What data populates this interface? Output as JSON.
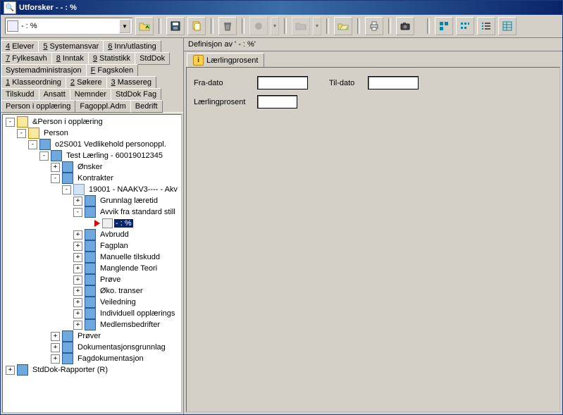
{
  "window": {
    "title": "Utforsker -  - : %"
  },
  "combo": {
    "text": " - : %"
  },
  "left_tabs": [
    [
      {
        "k": "4",
        "t": " Elever"
      },
      {
        "k": "5",
        "t": " Systemansvar"
      },
      {
        "k": "6",
        "t": " Inn/utlasting"
      }
    ],
    [
      {
        "k": "7",
        "t": " Fylkesavh"
      },
      {
        "k": "8",
        "t": " Inntak"
      },
      {
        "k": "9",
        "t": " Statistikk"
      },
      {
        "k": "",
        "t": "StdDok"
      }
    ],
    [
      {
        "k": "",
        "t": "Systemadministrasjon"
      },
      {
        "k": "F",
        "t": " Fagskolen"
      }
    ],
    [
      {
        "k": "1",
        "t": " Klasseordning"
      },
      {
        "k": "2",
        "t": " Søkere"
      },
      {
        "k": "3",
        "t": " Massereg"
      }
    ],
    [
      {
        "k": "",
        "t": "Tilskudd"
      },
      {
        "k": "",
        "t": "Ansatt"
      },
      {
        "k": "",
        "t": "Nemnder"
      },
      {
        "k": "",
        "t": "StdDok Fag"
      }
    ],
    [
      {
        "k": "",
        "t": "Person i opplæring",
        "active": true
      },
      {
        "k": "",
        "t": "Fagoppl.Adm"
      },
      {
        "k": "",
        "t": "Bedrift"
      }
    ]
  ],
  "tree": [
    {
      "d": 0,
      "x": "-",
      "i": "folder open",
      "t": "&Person i opplæring"
    },
    {
      "d": 1,
      "x": "-",
      "i": "folder open",
      "t": "Person"
    },
    {
      "d": 2,
      "x": "-",
      "i": "card",
      "t": "o2S001 Vedlikehold personoppl."
    },
    {
      "d": 3,
      "x": "-",
      "i": "card",
      "t": "Test Lærling - 60019012345"
    },
    {
      "d": 4,
      "x": "+",
      "i": "card",
      "t": "Ønsker"
    },
    {
      "d": 4,
      "x": "-",
      "i": "card",
      "t": "Kontrakter"
    },
    {
      "d": 5,
      "x": "-",
      "i": "doc",
      "t": "19001 - NAAKV3---- - Akv"
    },
    {
      "d": 6,
      "x": "+",
      "i": "card",
      "t": "Grunnlag læretid"
    },
    {
      "d": 6,
      "x": "-",
      "i": "card",
      "t": "Avvik fra standard still"
    },
    {
      "d": 7,
      "x": " ",
      "i": "sel",
      "t": " - : %",
      "sel": true
    },
    {
      "d": 6,
      "x": "+",
      "i": "card",
      "t": "Avbrudd"
    },
    {
      "d": 6,
      "x": "+",
      "i": "card",
      "t": "Fagplan"
    },
    {
      "d": 6,
      "x": "+",
      "i": "card",
      "t": "Manuelle tilskudd"
    },
    {
      "d": 6,
      "x": "+",
      "i": "card",
      "t": "Manglende Teori"
    },
    {
      "d": 6,
      "x": "+",
      "i": "card",
      "t": "Prøve"
    },
    {
      "d": 6,
      "x": "+",
      "i": "card",
      "t": "Øko. transer"
    },
    {
      "d": 6,
      "x": "+",
      "i": "card",
      "t": "Veiledning"
    },
    {
      "d": 6,
      "x": "+",
      "i": "card",
      "t": "Individuell opplærings"
    },
    {
      "d": 6,
      "x": "+",
      "i": "card",
      "t": "Medlemsbedrifter"
    },
    {
      "d": 4,
      "x": "+",
      "i": "card",
      "t": "Prøver"
    },
    {
      "d": 4,
      "x": "+",
      "i": "card",
      "t": "Dokumentasjonsgrunnlag"
    },
    {
      "d": 4,
      "x": "+",
      "i": "card",
      "t": "Fagdokumentasjon"
    },
    {
      "d": 0,
      "x": "+",
      "i": "card",
      "t": "StdDok-Rapporter (R)"
    }
  ],
  "right": {
    "defbar": "Definisjon av ' - : %'",
    "tab_label": "Lærlingprosent",
    "fra": "Fra-dato",
    "til": "Til-dato",
    "lp": "Lærlingprosent"
  }
}
